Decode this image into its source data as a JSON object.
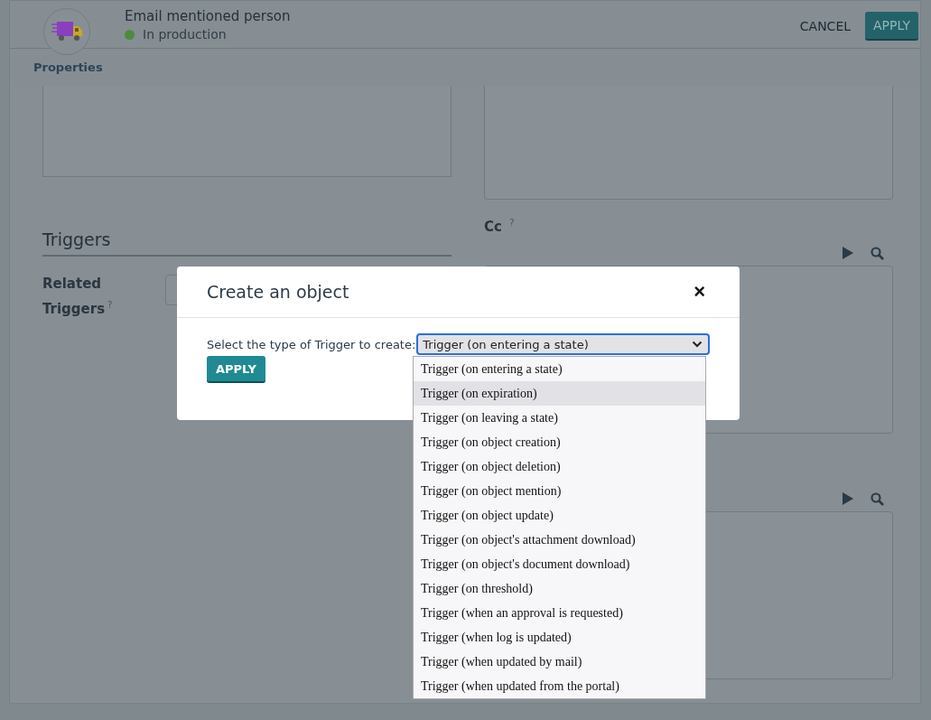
{
  "header": {
    "title": "Email mentioned person",
    "status": {
      "label": "In production",
      "color": "#4e8a3e"
    },
    "buttons": [
      {
        "label": "CANCEL",
        "kind": "flat"
      },
      {
        "label": "APPLY",
        "kind": "primary"
      }
    ]
  },
  "tabs": [
    {
      "label": "Properties"
    }
  ],
  "form": {
    "section": "Triggers",
    "related_label": "Related Triggers",
    "cc_label": "Cc",
    "help_mark": "?"
  },
  "dialog": {
    "title": "Create an object",
    "close": "×",
    "prompt": "Select the type of Trigger to create:",
    "select_value": "Trigger (on entering a state)",
    "button": "APPLY",
    "options": [
      {
        "label": "Trigger (on entering a state)",
        "highlighted": false
      },
      {
        "label": "Trigger (on expiration)",
        "highlighted": true
      },
      {
        "label": "Trigger (on leaving a state)",
        "highlighted": false
      },
      {
        "label": "Trigger (on object creation)",
        "highlighted": false
      },
      {
        "label": "Trigger (on object deletion)",
        "highlighted": false
      },
      {
        "label": "Trigger (on object mention)",
        "highlighted": false
      },
      {
        "label": "Trigger (on object update)",
        "highlighted": false
      },
      {
        "label": "Trigger (on object's attachment download)",
        "highlighted": false
      },
      {
        "label": "Trigger (on object's document download)",
        "highlighted": false
      },
      {
        "label": "Trigger (on threshold)",
        "highlighted": false
      },
      {
        "label": "Trigger (when an approval is requested)",
        "highlighted": false
      },
      {
        "label": "Trigger (when log is updated)",
        "highlighted": false
      },
      {
        "label": "Trigger (when updated by mail)",
        "highlighted": false
      },
      {
        "label": "Trigger (when updated from the portal)",
        "highlighted": false
      }
    ]
  }
}
